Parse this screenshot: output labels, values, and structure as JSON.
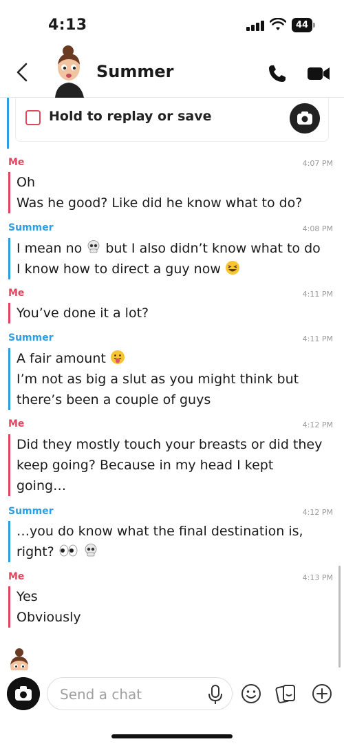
{
  "status_bar": {
    "time": "4:13",
    "battery": "44"
  },
  "header": {
    "contact_name": "Summer"
  },
  "snap": {
    "label": "Hold to replay or save"
  },
  "messages": [
    {
      "sender": "Me",
      "time": "4:07 PM",
      "lines": [
        "Oh",
        "Was he good? Like did he know what to do?"
      ]
    },
    {
      "sender": "Summer",
      "time": "4:08 PM",
      "line1_a": "I mean no",
      "line1_b": "but I also didn’t know what to do",
      "line2": "I know how to direct a guy now",
      "emojis": [
        "skull-emoji",
        "laughing-emoji"
      ]
    },
    {
      "sender": "Me",
      "time": "4:11 PM",
      "lines": [
        "You’ve done it a lot?"
      ]
    },
    {
      "sender": "Summer",
      "time": "4:11 PM",
      "line1": "A fair amount",
      "line2": "I’m not as big a slut as you might think but",
      "line3": "there’s been a couple of guys",
      "emojis": [
        "tongue-out-emoji"
      ]
    },
    {
      "sender": "Me",
      "time": "4:12 PM",
      "lines": [
        "Did they mostly touch your breasts or did they",
        "keep going? Because in my head I kept",
        "going…"
      ]
    },
    {
      "sender": "Summer",
      "time": "4:12 PM",
      "line1": "…you do know what the final destination is,",
      "line2": "right?",
      "emojis": [
        "eyes-emoji",
        "skull-emoji"
      ]
    },
    {
      "sender": "Me",
      "time": "4:13 PM",
      "lines": [
        "Yes",
        "Obviously"
      ]
    }
  ],
  "input": {
    "placeholder": "Send a chat"
  },
  "colors": {
    "me": "#e0465e",
    "them": "#2d9fe0",
    "bg": "#ffffff"
  }
}
